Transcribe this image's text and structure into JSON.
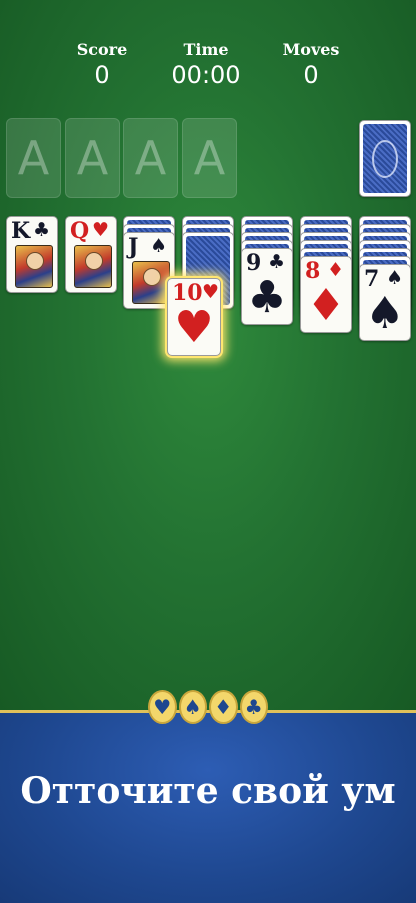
{
  "stats": {
    "score": {
      "label": "Score",
      "value": "0"
    },
    "time": {
      "label": "Time",
      "value": "00:00"
    },
    "moves": {
      "label": "Moves",
      "value": "0"
    }
  },
  "foundations": [
    "A",
    "A",
    "A",
    "A"
  ],
  "stock": {
    "face_down": true
  },
  "tableau": [
    {
      "rank": "K",
      "suit": "♣",
      "color": "black",
      "face_card": true,
      "hidden_below": 0
    },
    {
      "rank": "Q",
      "suit": "♥",
      "color": "red",
      "face_card": true,
      "hidden_below": 0
    },
    {
      "rank": "J",
      "suit": "♠",
      "color": "black",
      "face_card": true,
      "hidden_below": 2
    },
    {
      "rank": "10",
      "suit": "♥",
      "color": "red",
      "face_card": false,
      "hidden_below": 3,
      "highlighted": true
    },
    {
      "rank": "9",
      "suit": "♣",
      "color": "black",
      "face_card": false,
      "hidden_below": 4
    },
    {
      "rank": "8",
      "suit": "♦",
      "color": "red",
      "face_card": false,
      "hidden_below": 5
    },
    {
      "rank": "7",
      "suit": "♠",
      "color": "black",
      "face_card": false,
      "hidden_below": 6
    }
  ],
  "ornament_suits": [
    "♥",
    "♠",
    "♦",
    "♣"
  ],
  "tagline": "Отточите свой ум",
  "colors": {
    "felt": "#237232",
    "banner": "#1e478f",
    "gold": "#e0c15a",
    "highlight": "#ffe67a"
  }
}
